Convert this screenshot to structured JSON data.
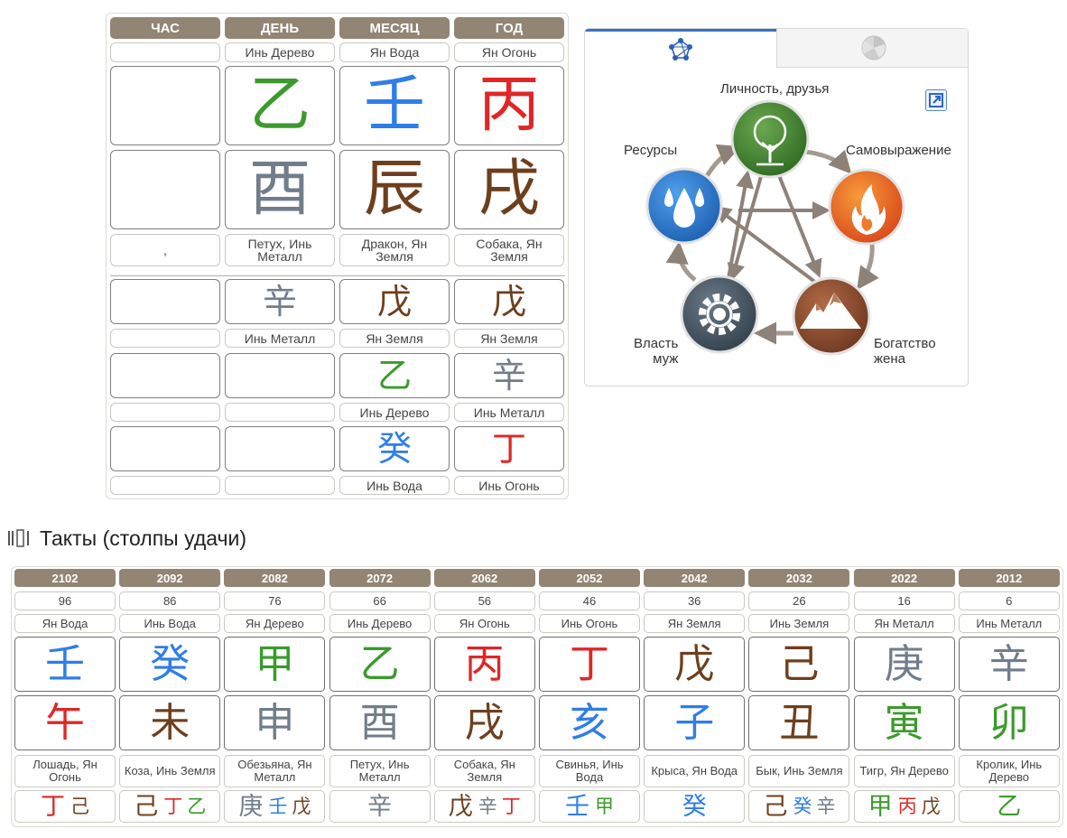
{
  "chart": {
    "headers": [
      "ЧАС",
      "ДЕНЬ",
      "МЕСЯЦ",
      "ГОД"
    ],
    "stem_labels": [
      "",
      "Инь Дерево",
      "Ян Вода",
      "Ян Огонь"
    ],
    "stems": [
      "",
      "乙",
      "壬",
      "丙"
    ],
    "branches": [
      "",
      "酉",
      "辰",
      "戌"
    ],
    "branch_labels": [
      ",",
      "Петух, Инь Металл",
      "Дракон, Ян Земля",
      "Собака, Ян Земля"
    ],
    "hidden_rows": [
      {
        "stems": [
          "",
          "辛",
          "戊",
          "戊"
        ],
        "labels": [
          "",
          "Инь Металл",
          "Ян Земля",
          "Ян Земля"
        ]
      },
      {
        "stems": [
          "",
          "",
          "乙",
          "辛"
        ],
        "labels": [
          "",
          "",
          "Инь Дерево",
          "Инь Металл"
        ]
      },
      {
        "stems": [
          "",
          "",
          "癸",
          "丁"
        ],
        "labels": [
          "",
          "",
          "Инь Вода",
          "Инь Огонь"
        ]
      }
    ]
  },
  "widget": {
    "tab1_icon": "network-pentagon-icon",
    "tab2_icon": "pie-chart-icon",
    "labels": {
      "top": "Личность, друзья",
      "right": "Самовыражение",
      "left": "Ресурсы",
      "bottom_right": "Богатство\nжена",
      "bottom_left": "Власть\nмуж"
    },
    "elements": {
      "wood": "tree-icon",
      "fire": "flame-icon",
      "earth": "mountain-icon",
      "metal": "gear-icon",
      "water": "water-drops-icon"
    },
    "colors": {
      "wood": "#4e8a36",
      "fire": "#e85a22",
      "earth": "#8a4d2e",
      "metal": "#4a5866",
      "water": "#2f7fd6",
      "arrow": "#8d8178"
    }
  },
  "luck": {
    "title_icon": "pillars-icon",
    "title": "Такты (столпы удачи)",
    "pillars": [
      {
        "year": "2102",
        "age": "96",
        "stem_label": "Ян Вода",
        "stem": "壬",
        "branch": "午",
        "branch_label": "Лошадь, Ян Огонь",
        "hidden": [
          "丁",
          "己"
        ]
      },
      {
        "year": "2092",
        "age": "86",
        "stem_label": "Инь Вода",
        "stem": "癸",
        "branch": "未",
        "branch_label": "Коза, Инь Земля",
        "hidden": [
          "己",
          "丁",
          "乙"
        ]
      },
      {
        "year": "2082",
        "age": "76",
        "stem_label": "Ян Дерево",
        "stem": "甲",
        "branch": "申",
        "branch_label": "Обезьяна, Ян Металл",
        "hidden": [
          "庚",
          "壬",
          "戊"
        ]
      },
      {
        "year": "2072",
        "age": "66",
        "stem_label": "Инь Дерево",
        "stem": "乙",
        "branch": "酉",
        "branch_label": "Петух, Инь Металл",
        "hidden": [
          "辛"
        ]
      },
      {
        "year": "2062",
        "age": "56",
        "stem_label": "Ян Огонь",
        "stem": "丙",
        "branch": "戌",
        "branch_label": "Собака, Ян Земля",
        "hidden": [
          "戊",
          "辛",
          "丁"
        ]
      },
      {
        "year": "2052",
        "age": "46",
        "stem_label": "Инь Огонь",
        "stem": "丁",
        "branch": "亥",
        "branch_label": "Свинья, Инь Вода",
        "hidden": [
          "壬",
          "甲"
        ]
      },
      {
        "year": "2042",
        "age": "36",
        "stem_label": "Ян Земля",
        "stem": "戊",
        "branch": "子",
        "branch_label": "Крыса, Ян Вода",
        "hidden": [
          "癸"
        ]
      },
      {
        "year": "2032",
        "age": "26",
        "stem_label": "Инь Земля",
        "stem": "己",
        "branch": "丑",
        "branch_label": "Бык, Инь Земля",
        "hidden": [
          "己",
          "癸",
          "辛"
        ]
      },
      {
        "year": "2022",
        "age": "16",
        "stem_label": "Ян Металл",
        "stem": "庚",
        "branch": "寅",
        "branch_label": "Тигр, Ян Дерево",
        "hidden": [
          "甲",
          "丙",
          "戊"
        ]
      },
      {
        "year": "2012",
        "age": "6",
        "stem_label": "Инь Металл",
        "stem": "辛",
        "branch": "卯",
        "branch_label": "Кролик, Инь Дерево",
        "hidden": [
          "乙"
        ]
      }
    ]
  }
}
